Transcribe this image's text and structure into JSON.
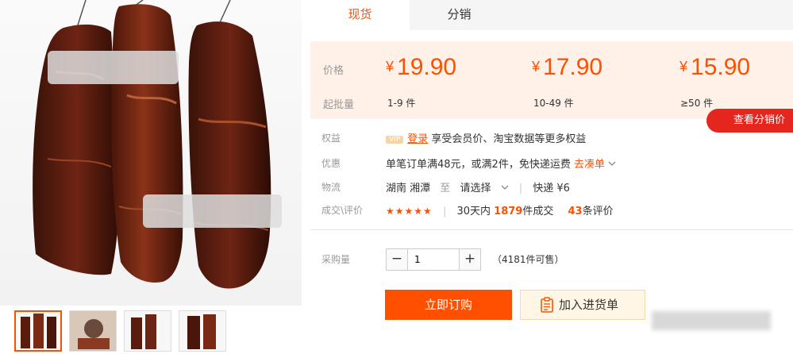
{
  "tabs": [
    {
      "label": "现货",
      "active": true
    },
    {
      "label": "分销",
      "active": false
    }
  ],
  "price_box": {
    "price_label": "价格",
    "moq_label": "起批量",
    "currency": "¥",
    "tiers": [
      {
        "price": "19.90",
        "range": "1-9 件"
      },
      {
        "price": "17.90",
        "range": "10-49 件"
      },
      {
        "price": "15.90",
        "range": "≥50 件"
      }
    ],
    "distribution_button": "查看分销价"
  },
  "benefits": {
    "label": "权益",
    "vip_badge": "VIP",
    "login_link": "登录",
    "text": "享受会员价、淘宝数据等更多权益"
  },
  "promo": {
    "label": "优惠",
    "text": "单笔订单满48元，或满2件，免快递运费",
    "link": "去凑单"
  },
  "logistics": {
    "label": "物流",
    "origin": "湖南 湘潭",
    "to": "至",
    "select": "请选择",
    "shipping": "快递 ¥6"
  },
  "deals": {
    "label": "成交\\评价",
    "rating": 4.5,
    "stars": "★★★★★",
    "prefix": "30天内",
    "count": "1879",
    "suffix": "件成交",
    "reviews": "43",
    "reviews_suffix": "条评价"
  },
  "purchase": {
    "qty_label": "采购量",
    "minus": "−",
    "plus": "+",
    "quantity": "1",
    "stock": "（4181件可售）",
    "buy_button": "立即订购",
    "cart_button": "加入进货单"
  },
  "colors": {
    "accent": "#ff5000",
    "price_bg": "#fff0e8",
    "distribution_button": "#e4261e",
    "cart_button_bg": "#fff6e5"
  },
  "icons": [
    "chevron-down-icon",
    "cart-list-icon",
    "star-icon"
  ]
}
